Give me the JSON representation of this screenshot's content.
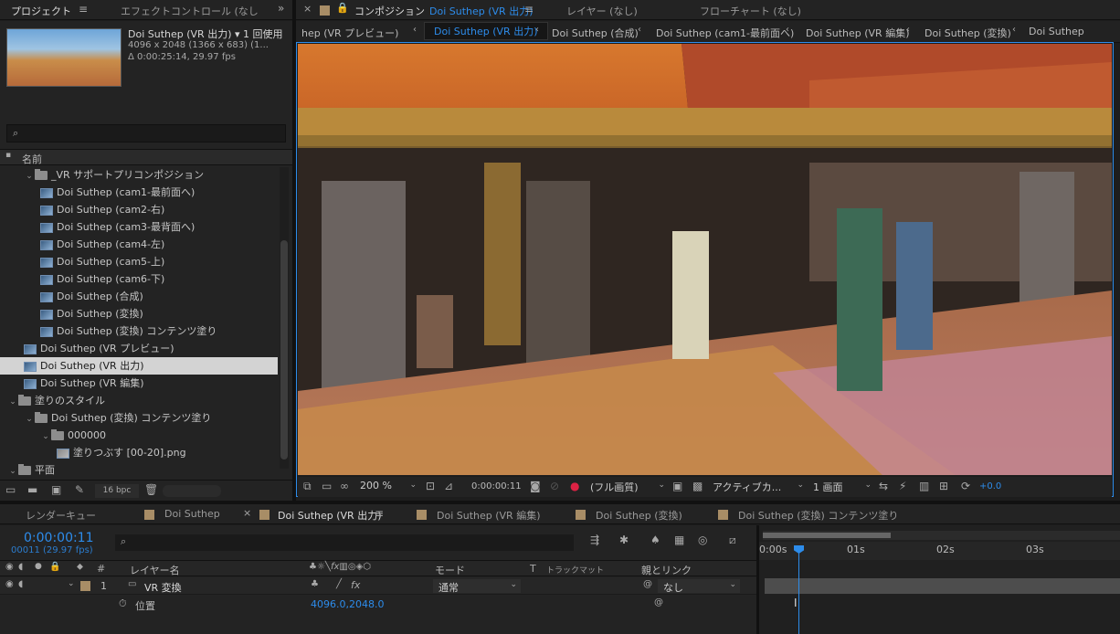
{
  "project_panel": {
    "tab_label": "プロジェクト",
    "effect_tab": "エフェクトコントロール (なし",
    "item_name": "Doi Suthep (VR 出力) ▾",
    "usage": "1 回使用",
    "dims": "4096 x 2048  (1366 x 683) (1...",
    "duration": "Δ 0:00:25:14, 29.97 fps",
    "search_placeholder": "",
    "col_name": "名前",
    "bpc": "16 bpc"
  },
  "tree": [
    {
      "label": "_VR サポートプリコンポジション",
      "type": "folder",
      "expanded": true
    },
    {
      "label": "Doi Suthep (cam1-最前面へ)",
      "type": "comp"
    },
    {
      "label": "Doi Suthep (cam2-右)",
      "type": "comp"
    },
    {
      "label": "Doi Suthep (cam3-最背面へ)",
      "type": "comp"
    },
    {
      "label": "Doi Suthep (cam4-左)",
      "type": "comp"
    },
    {
      "label": "Doi Suthep (cam5-上)",
      "type": "comp"
    },
    {
      "label": "Doi Suthep (cam6-下)",
      "type": "comp"
    },
    {
      "label": "Doi Suthep (合成)",
      "type": "comp"
    },
    {
      "label": "Doi Suthep (変換)",
      "type": "comp"
    },
    {
      "label": "Doi Suthep (変換) コンテンツ塗り",
      "type": "comp"
    },
    {
      "label": "Doi Suthep (VR プレビュー)",
      "type": "comp"
    },
    {
      "label": "Doi Suthep (VR 出力)",
      "type": "comp",
      "selected": true
    },
    {
      "label": "Doi Suthep (VR 編集)",
      "type": "comp"
    },
    {
      "label": "塗りのスタイル",
      "type": "folder",
      "expanded": true
    },
    {
      "label": "Doi Suthep (変換) コンテンツ塗り",
      "type": "folder",
      "expanded": true
    },
    {
      "label": "000000",
      "type": "folder",
      "expanded": true
    },
    {
      "label": "塗りつぶす [00-20].png",
      "type": "footage"
    },
    {
      "label": "平面",
      "type": "folder",
      "expanded": true
    }
  ],
  "comp_panel": {
    "tab_prefix": "コンポジション",
    "tab_name": "Doi Suthep (VR 出力)",
    "layer_tab": "レイヤー (なし)",
    "flow_tab": "フローチャート (なし)",
    "breadcrumbs": [
      "hep (VR プレビュー)",
      "Doi Suthep (VR 出力)",
      "Doi Suthep (合成)",
      "Doi Suthep (cam1-最前面へ)",
      "Doi Suthep (VR 編集)",
      "Doi Suthep (変換)",
      "Doi Suthep"
    ],
    "zoom": "200 %",
    "timecode": "0:00:00:11",
    "resolution": "(フル画質)",
    "camera": "アクティブカ...",
    "views": "1 画面",
    "exposure": "+0.0"
  },
  "timeline_tabs": [
    "レンダーキュー",
    "Doi Suthep",
    "Doi Suthep (VR 出力)",
    "Doi Suthep (VR 編集)",
    "Doi Suthep (変換)",
    "Doi Suthep (変換) コンテンツ塗り"
  ],
  "timeline": {
    "timecode": "0:00:00:11",
    "frames": "00011 (29.97 fps)",
    "col_layer_name": "レイヤー名",
    "col_mode": "モード",
    "col_t": "T",
    "col_trackmatte": "トラックマット",
    "col_parent": "親とリンク",
    "ruler": [
      "0:00s",
      "01s",
      "02s",
      "03s"
    ],
    "layer": {
      "num": "1",
      "name": "VR 変換",
      "mode": "通常",
      "parent": "なし"
    },
    "property": {
      "name": "位置",
      "value": "4096.0,2048.0"
    }
  },
  "colors": {
    "accent": "#2d8ceb",
    "selected_row": "#d3d3d3",
    "label_swatch": "#a88d66"
  }
}
